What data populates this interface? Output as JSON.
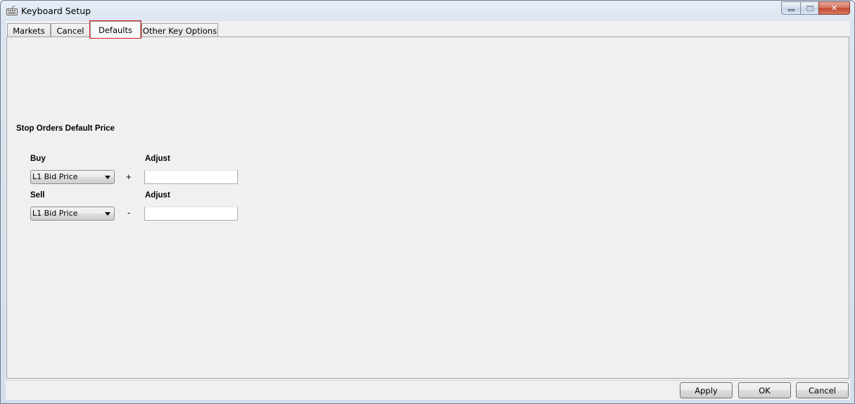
{
  "window": {
    "title": "Keyboard Setup",
    "icon": "keyboard-icon",
    "controls": {
      "minimize": "minimize-icon",
      "maximize": "maximize-icon",
      "close": "close-icon"
    }
  },
  "tabs": [
    {
      "label": "Markets",
      "active": false
    },
    {
      "label": "Cancel",
      "active": false
    },
    {
      "label": "Defaults",
      "active": true
    },
    {
      "label": "Other Key Options",
      "active": false
    }
  ],
  "defaults": {
    "section_title": "Stop Orders Default Price",
    "buy": {
      "label": "Buy",
      "adjust_label": "Adjust",
      "price_source": "L1 Bid Price",
      "operator": "+",
      "adjust_value": ""
    },
    "sell": {
      "label": "Sell",
      "adjust_label": "Adjust",
      "price_source": "L1 Bid Price",
      "operator": "-",
      "adjust_value": ""
    }
  },
  "footer": {
    "apply": "Apply",
    "ok": "OK",
    "cancel": "Cancel"
  },
  "colors": {
    "active_tab_highlight": "#d91e1e",
    "client_bg": "#f0f0f0"
  }
}
